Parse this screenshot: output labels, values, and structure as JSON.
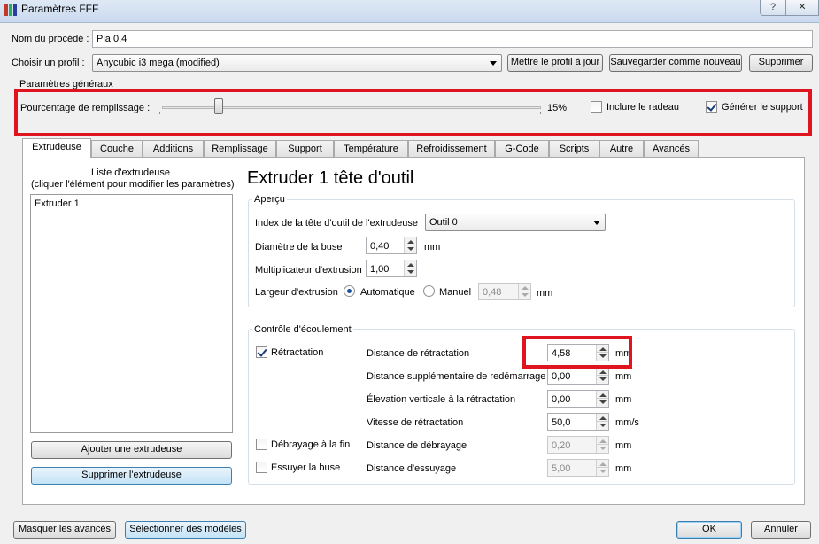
{
  "window": {
    "title": "Paramètres FFF",
    "help_label": "?",
    "close_label": "✕"
  },
  "top": {
    "process_name_label": "Nom du procédé :",
    "process_name_value": "Pla 0.4",
    "profile_label": "Choisir un profil :",
    "profile_value": "Anycubic i3 mega (modified)",
    "update_profile_button": "Mettre le profil à jour",
    "save_new_button": "Sauvegarder comme nouveau",
    "delete_button": "Supprimer"
  },
  "general": {
    "group_title": "Paramètres généraux",
    "infill_label": "Pourcentage de remplissage :",
    "infill_value_text": "15%",
    "infill_percent": 15,
    "raft_label": "Inclure le radeau",
    "raft_checked": false,
    "support_label": "Générer le support",
    "support_checked": true
  },
  "tabs": [
    "Extrudeuse",
    "Couche",
    "Additions",
    "Remplissage",
    "Support",
    "Température",
    "Refroidissement",
    "G-Code",
    "Scripts",
    "Autre",
    "Avancés"
  ],
  "extruder_list": {
    "title_line1": "Liste d'extrudeuse",
    "title_line2": "(cliquer l'élément pour modifier les paramètres)",
    "items": [
      "Extruder 1"
    ],
    "add_button": "Ajouter une extrudeuse",
    "remove_button": "Supprimer l'extrudeuse"
  },
  "extruder": {
    "heading": "Extruder 1 tête d'outil",
    "overview": {
      "title": "Aperçu",
      "tool_index_label": "Index de la tête d'outil de l'extrudeuse",
      "tool_index_value": "Outil 0",
      "nozzle_label": "Diamètre de la buse",
      "nozzle_value": "0,40",
      "nozzle_unit": "mm",
      "multiplier_label": "Multiplicateur d'extrusion",
      "multiplier_value": "1,00",
      "width_label": "Largeur d'extrusion",
      "auto_label": "Automatique",
      "manual_label": "Manuel",
      "manual_value": "0,48",
      "manual_unit": "mm"
    },
    "flow": {
      "title": "Contrôle d'écoulement",
      "retraction_label": "Rétractation",
      "retraction_checked": true,
      "coast_label": "Débrayage à la fin",
      "coast_checked": false,
      "wipe_label": "Essuyer la buse",
      "wipe_checked": false,
      "fields": [
        {
          "label": "Distance de rétractation",
          "value": "4,58",
          "unit": "mm"
        },
        {
          "label": "Distance supplémentaire de redémarrage",
          "value": "0,00",
          "unit": "mm"
        },
        {
          "label": "Élevation verticale à la rétractation",
          "value": "0,00",
          "unit": "mm"
        },
        {
          "label": "Vitesse de rétractation",
          "value": "50,0",
          "unit": "mm/s"
        },
        {
          "label": "Distance de débrayage",
          "value": "0,20",
          "unit": "mm"
        },
        {
          "label": "Distance d'essuyage",
          "value": "5,00",
          "unit": "mm"
        }
      ]
    }
  },
  "footer": {
    "hide_advanced_button": "Masquer les avancés",
    "select_models_button": "Sélectionner des modèles",
    "ok_button": "OK",
    "cancel_button": "Annuler"
  },
  "colors": {
    "highlight_red": "#e0141e",
    "accent_blue": "#3c7fb1"
  }
}
